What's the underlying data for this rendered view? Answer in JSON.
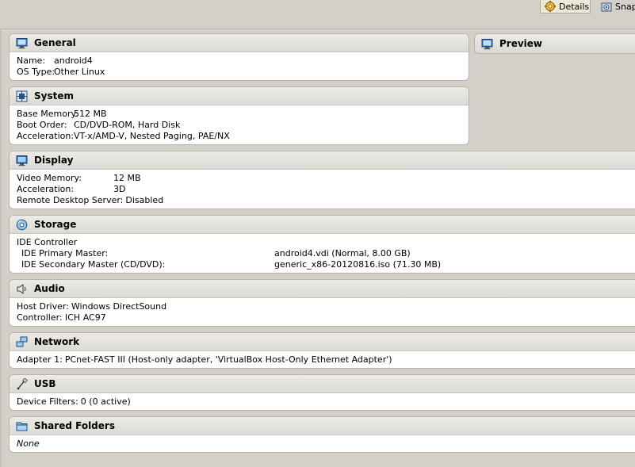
{
  "toolbar": {
    "details_label": "Details",
    "snapshots_label": "Snap"
  },
  "preview": {
    "title": "Preview"
  },
  "general": {
    "title": "General",
    "rows": [
      {
        "key": "Name:",
        "value": "android4"
      },
      {
        "key": "OS Type:",
        "value": "Other Linux"
      }
    ]
  },
  "system": {
    "title": "System",
    "rows": [
      {
        "key": "Base Memory:",
        "value": "512 MB"
      },
      {
        "key": "Boot Order:",
        "value": "CD/DVD-ROM, Hard Disk"
      },
      {
        "key": "Acceleration:",
        "value": "VT-x/AMD-V, Nested Paging, PAE/NX"
      }
    ]
  },
  "display": {
    "title": "Display",
    "rows": [
      {
        "key": "Video Memory:",
        "value": "12 MB"
      },
      {
        "key": "Acceleration:",
        "value": "3D"
      },
      {
        "key": "Remote Desktop Server:",
        "value": "Disabled"
      }
    ]
  },
  "storage": {
    "title": "Storage",
    "controller": "IDE Controller",
    "rows": [
      {
        "key": "IDE Primary Master:",
        "value": "android4.vdi (Normal, 8.00 GB)"
      },
      {
        "key": "IDE Secondary Master (CD/DVD):",
        "value": "generic_x86-20120816.iso (71.30 MB)"
      }
    ]
  },
  "audio": {
    "title": "Audio",
    "rows": [
      {
        "key": "Host Driver:",
        "value": "Windows DirectSound"
      },
      {
        "key": "Controller:",
        "value": "ICH AC97"
      }
    ]
  },
  "network": {
    "title": "Network",
    "rows": [
      {
        "key": "Adapter 1:",
        "value": "PCnet-FAST III (Host-only adapter, 'VirtualBox Host-Only Ethernet Adapter')"
      }
    ]
  },
  "usb": {
    "title": "USB",
    "rows": [
      {
        "key": "Device Filters:",
        "value": "0 (0 active)"
      }
    ]
  },
  "shared_folders": {
    "title": "Shared Folders",
    "value": "None"
  },
  "colors": {
    "background": "#d4d0c8",
    "header_gradient_top": "#ecebe6",
    "header_gradient_bottom": "#dcdad3",
    "panel_body": "#ffffff",
    "border": "#b6b3ac"
  },
  "icons": {
    "details": "gear-icon",
    "snapshots": "camera-icon",
    "preview": "monitor-icon",
    "general": "monitor-icon",
    "system": "chip-icon",
    "display": "display-icon",
    "storage": "disk-icon",
    "audio": "speaker-icon",
    "network": "network-icon",
    "usb": "usb-icon",
    "shared_folders": "folder-icon"
  }
}
